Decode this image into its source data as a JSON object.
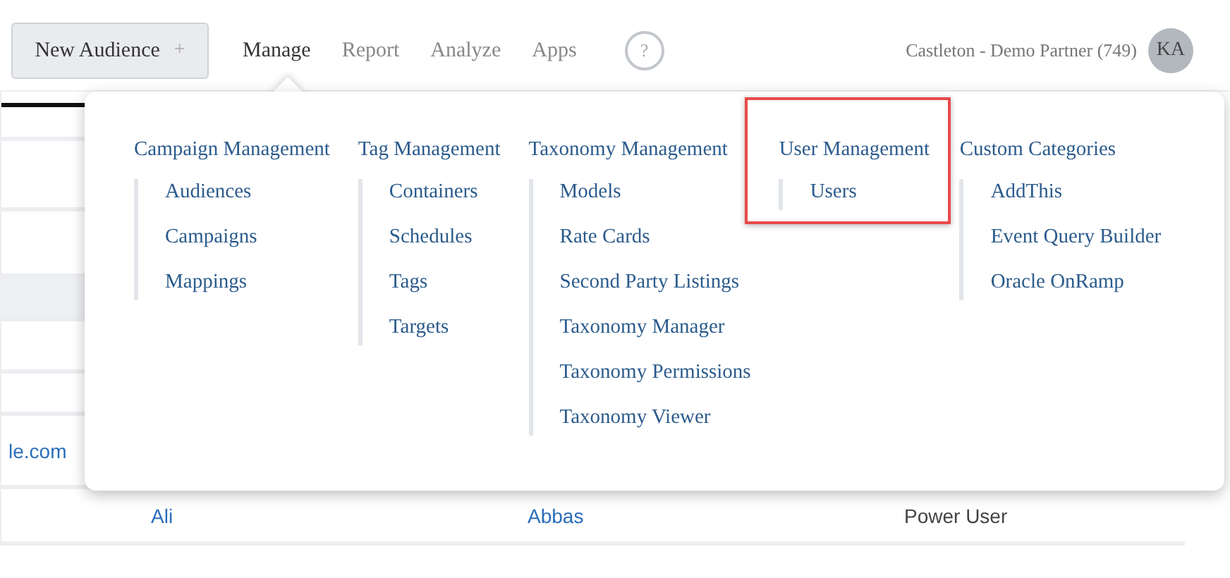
{
  "header": {
    "new_button": {
      "label": "New Audience",
      "icon": "+"
    },
    "nav": [
      {
        "label": "Manage",
        "selected": true
      },
      {
        "label": "Report",
        "selected": false
      },
      {
        "label": "Analyze",
        "selected": false
      },
      {
        "label": "Apps",
        "selected": false
      }
    ],
    "help": "?",
    "account": "Castleton - Demo Partner (749)",
    "avatar": "KA"
  },
  "menu": {
    "columns": [
      {
        "heading": "Campaign Management",
        "highlighted": false,
        "items": [
          "Audiences",
          "Campaigns",
          "Mappings"
        ]
      },
      {
        "heading": "Tag Management",
        "highlighted": false,
        "items": [
          "Containers",
          "Schedules",
          "Tags",
          "Targets"
        ]
      },
      {
        "heading": "Taxonomy Management",
        "highlighted": false,
        "items": [
          "Models",
          "Rate Cards",
          "Second Party Listings",
          "Taxonomy Manager",
          "Taxonomy Permissions",
          "Taxonomy Viewer"
        ]
      },
      {
        "heading": "User Management",
        "highlighted": true,
        "items": [
          "Users"
        ]
      },
      {
        "heading": "Custom Categories",
        "highlighted": false,
        "items": [
          "AddThis",
          "Event Query Builder",
          "Oracle OnRamp"
        ]
      }
    ]
  },
  "table": {
    "rows": [
      {
        "cells": [],
        "selected": false
      },
      {
        "cells": [],
        "selected": false
      },
      {
        "cells": [],
        "selected": false
      },
      {
        "cells": [],
        "selected": true
      },
      {
        "cells": [],
        "selected": false
      },
      {
        "cells": [],
        "selected": false
      },
      {
        "cells": [
          "le.com"
        ],
        "selected": false
      },
      {
        "cells": [
          "",
          "Ali",
          "Abbas",
          "Power User"
        ],
        "selected": false
      }
    ]
  }
}
